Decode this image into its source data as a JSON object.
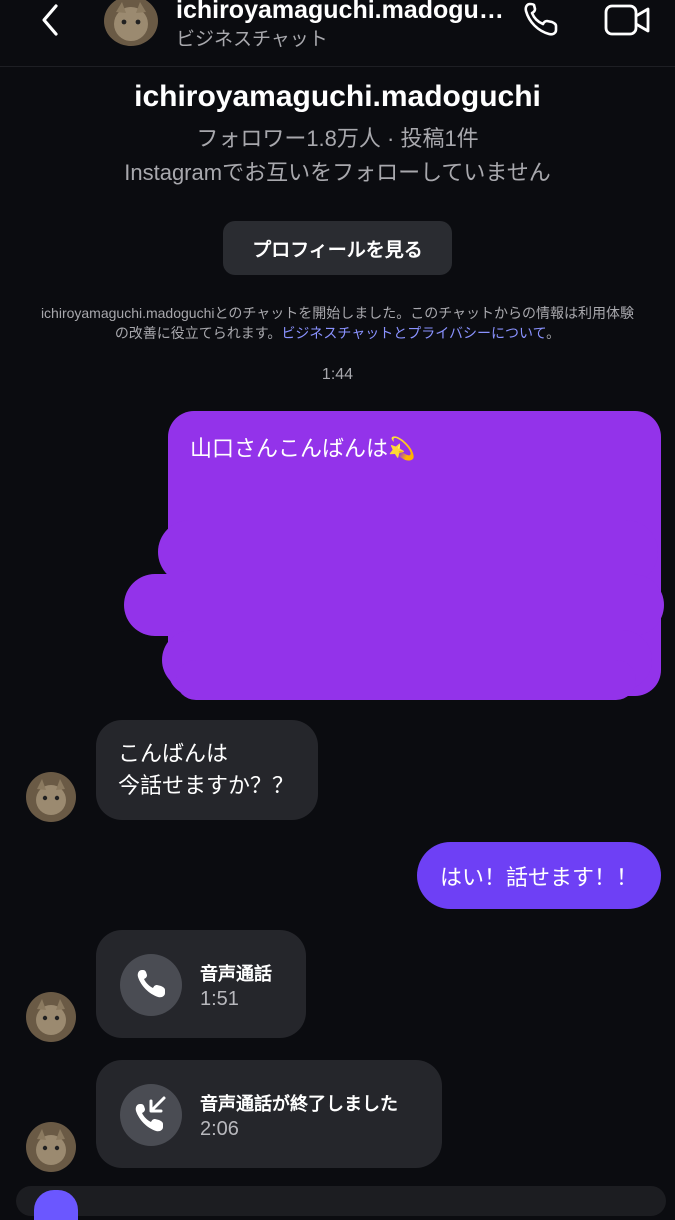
{
  "header": {
    "username": "ichiroyamaguchi.madoguchi",
    "subtitle": "ビジネスチャット"
  },
  "profile": {
    "name": "ichiroyamaguchi.madoguchi",
    "stats": "フォロワー1.8万人 · 投稿1件",
    "follow_status": "Instagramでお互いをフォローしていません",
    "view_profile_label": "プロフィールを見る"
  },
  "notice": {
    "line1": "ichiroyamaguchi.madoguchiとのチャットを開始しました。このチャットからの情報は利用体験",
    "line2_prefix": "の改善に役立てられます。",
    "link": "ビジネスチャットとプライバシーについて",
    "line2_suffix": "。"
  },
  "timestamp": "1:44",
  "messages": {
    "out1": "山口さんこんばんは",
    "out1_emoji": "💫",
    "in1_line1": "こんばんは",
    "in1_line2": "今話せますか？？",
    "out2": "はい！話せます！！",
    "call1_title": "音声通話",
    "call1_duration": "1:51",
    "call2_title": "音声通話が終了しました",
    "call2_duration": "2:06"
  },
  "icons": {
    "back": "chevron-left-icon",
    "call": "phone-icon",
    "video": "video-camera-icon",
    "incoming_call": "phone-incoming-icon"
  },
  "colors": {
    "background": "#0b0c10",
    "outgoing_bubble": "#9333ea",
    "reply_bubble": "#6e40f5",
    "incoming_bubble": "#25262b",
    "link": "#8a92ff"
  }
}
